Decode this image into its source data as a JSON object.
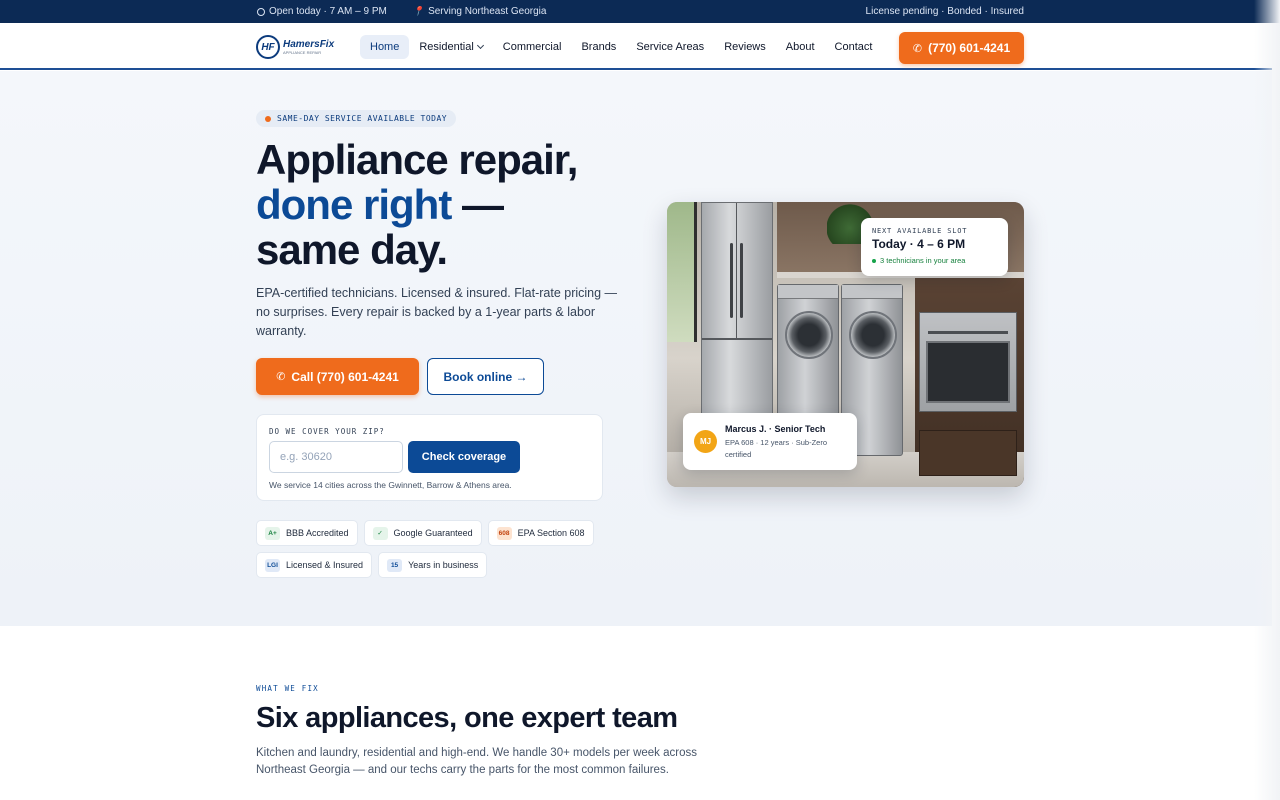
{
  "topbar": {
    "hours": "Open today · 7 AM – 9 PM",
    "area": "Serving Northeast Georgia",
    "license": "License pending · Bonded · Insured"
  },
  "brand": {
    "logo_mark": "HF",
    "name": "HamersFix",
    "tagline": "APPLIANCE REPAIR"
  },
  "nav": {
    "items": [
      {
        "label": "Home",
        "active": true
      },
      {
        "label": "Residential",
        "dropdown": true
      },
      {
        "label": "Commercial"
      },
      {
        "label": "Brands"
      },
      {
        "label": "Service Areas"
      },
      {
        "label": "Reviews"
      },
      {
        "label": "About"
      },
      {
        "label": "Contact"
      }
    ],
    "cta_phone": "(770) 601-4241"
  },
  "hero": {
    "pill": "SAME-DAY SERVICE AVAILABLE TODAY",
    "title_line1": "Appliance repair,",
    "title_line2_accent": "done right",
    "title_line2_rest": " —",
    "title_line3": "same day.",
    "lead": "EPA-certified technicians. Licensed & insured. Flat-rate pricing — no surprises. Every repair is backed by a 1-year parts & labor warranty.",
    "call_label": "Call (770) 601-4241",
    "book_label": "Book online →"
  },
  "zip": {
    "label": "DO WE COVER YOUR ZIP?",
    "placeholder": "e.g. 30620",
    "button": "Check coverage",
    "note": "We service 14 cities across the Gwinnett, Barrow & Athens area."
  },
  "badges": [
    {
      "icon": "A+",
      "label": "BBB Accredited",
      "tone": "green"
    },
    {
      "icon": "✓",
      "label": "Google Guaranteed",
      "tone": "green"
    },
    {
      "icon": "608",
      "label": "EPA Section 608",
      "tone": "orange"
    },
    {
      "icon": "LGI",
      "label": "Licensed & Insured",
      "tone": "blue"
    },
    {
      "icon": "15",
      "label": "Years in business",
      "tone": "blue"
    }
  ],
  "slot": {
    "label": "NEXT AVAILABLE SLOT",
    "time": "Today · 4 – 6 PM",
    "note": "3 technicians in your area"
  },
  "tech": {
    "initials": "MJ",
    "name": "Marcus J. · Senior Tech",
    "meta": "EPA 608 · 12 years · Sub-Zero certified"
  },
  "section2": {
    "eyebrow": "WHAT WE FIX",
    "title": "Six appliances, one expert team",
    "sub": "Kitchen and laundry, residential and high-end. We handle 30+ models per week across Northeast Georgia — and our techs carry the parts for the most common failures."
  },
  "colors": {
    "navy": "#0c2a55",
    "brand_blue": "#0c4a96",
    "orange": "#ef6b1c",
    "green": "#16803d"
  }
}
